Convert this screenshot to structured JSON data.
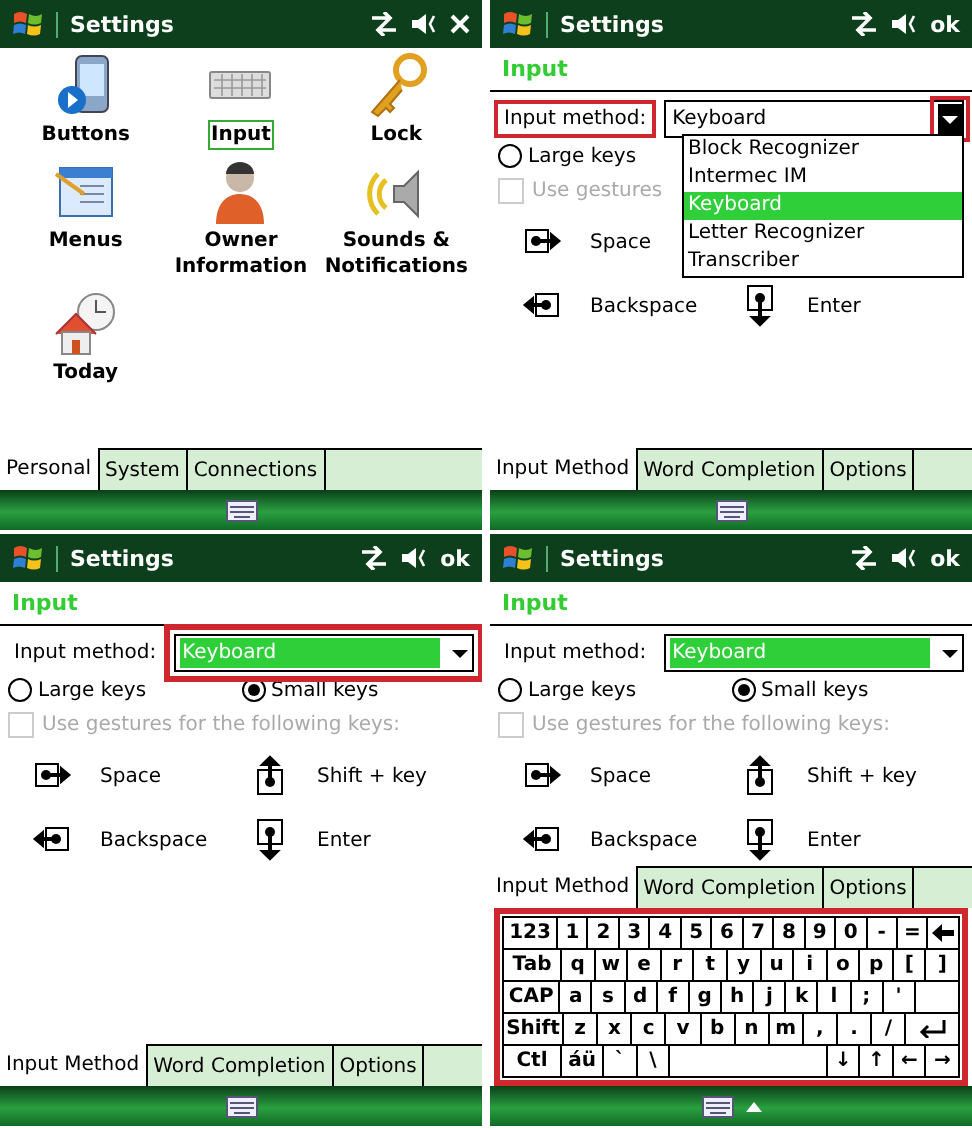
{
  "panels": [
    {
      "kind": "grid",
      "title": "Settings",
      "close": true,
      "items": [
        {
          "label": "Buttons",
          "selected": false
        },
        {
          "label": "Input",
          "selected": true
        },
        {
          "label": "Lock",
          "selected": false
        },
        {
          "label": "Menus",
          "selected": false
        },
        {
          "label": "Owner Information",
          "selected": false
        },
        {
          "label": "Sounds & Notifications",
          "selected": false
        },
        {
          "label": "Today",
          "selected": false
        }
      ],
      "tabs": [
        {
          "label": "Personal",
          "selected": true
        },
        {
          "label": "System",
          "selected": false
        },
        {
          "label": "Connections",
          "selected": false
        }
      ]
    },
    {
      "kind": "input",
      "title": "Settings",
      "action": "ok",
      "heading": "Input",
      "method_label": "Input method:",
      "label_highlight": true,
      "method_value": "Keyboard",
      "value_selected": false,
      "field_highlight": false,
      "arrow_highlight": true,
      "options": [
        {
          "label": "Block Recognizer",
          "selected": false
        },
        {
          "label": "Intermec IM",
          "selected": false
        },
        {
          "label": "Keyboard",
          "selected": true
        },
        {
          "label": "Letter Recognizer",
          "selected": false
        },
        {
          "label": "Transcriber",
          "selected": false
        }
      ],
      "radios": [
        {
          "label": "Large keys",
          "selected": false
        }
      ],
      "gesture_checkbox": {
        "label": "Use gestures",
        "checked": false,
        "disabled": true
      },
      "gestures": [
        {
          "kind": "space",
          "label": "Space"
        },
        {
          "kind": "backspace",
          "label": "Backspace"
        },
        {
          "kind": "enter",
          "label": "Enter"
        }
      ],
      "tabs": [
        {
          "label": "Input Method",
          "selected": true
        },
        {
          "label": "Word Completion",
          "selected": false
        },
        {
          "label": "Options",
          "selected": false
        }
      ]
    },
    {
      "kind": "input",
      "title": "Settings",
      "action": "ok",
      "heading": "Input",
      "method_label": "Input method:",
      "label_highlight": false,
      "method_value": "Keyboard",
      "value_selected": true,
      "field_highlight": true,
      "arrow_highlight": false,
      "radios": [
        {
          "label": "Large keys",
          "selected": false
        },
        {
          "label": "Small keys",
          "selected": true
        }
      ],
      "gesture_checkbox": {
        "label": "Use gestures for the following keys:",
        "checked": false,
        "disabled": true
      },
      "gestures": [
        {
          "kind": "space",
          "label": "Space"
        },
        {
          "kind": "shift",
          "label": "Shift + key"
        },
        {
          "kind": "backspace",
          "label": "Backspace"
        },
        {
          "kind": "enter",
          "label": "Enter"
        }
      ],
      "tabs": [
        {
          "label": "Input Method",
          "selected": true
        },
        {
          "label": "Word Completion",
          "selected": false
        },
        {
          "label": "Options",
          "selected": false
        }
      ]
    },
    {
      "kind": "input",
      "title": "Settings",
      "action": "ok",
      "heading": "Input",
      "method_label": "Input method:",
      "label_highlight": false,
      "method_value": "Keyboard",
      "value_selected": true,
      "field_highlight": false,
      "arrow_highlight": false,
      "radios": [
        {
          "label": "Large keys",
          "selected": false
        },
        {
          "label": "Small keys",
          "selected": true
        }
      ],
      "gesture_checkbox": {
        "label": "Use gestures for the following keys:",
        "checked": false,
        "disabled": true
      },
      "gestures": [
        {
          "kind": "space",
          "label": "Space"
        },
        {
          "kind": "shift",
          "label": "Shift + key"
        },
        {
          "kind": "backspace",
          "label": "Backspace"
        },
        {
          "kind": "enter",
          "label": "Enter"
        }
      ],
      "tabs": [
        {
          "label": "Input Method",
          "selected": true
        },
        {
          "label": "Word Completion",
          "selected": false
        },
        {
          "label": "Options",
          "selected": false
        }
      ],
      "keyboard": {
        "highlight": true,
        "rows": [
          {
            "keys": [
              {
                "kind": "text",
                "label": "123"
              },
              {
                "kind": "text",
                "label": "1"
              },
              {
                "kind": "text",
                "label": "2"
              },
              {
                "kind": "text",
                "label": "3"
              },
              {
                "kind": "text",
                "label": "4"
              },
              {
                "kind": "text",
                "label": "5"
              },
              {
                "kind": "text",
                "label": "6"
              },
              {
                "kind": "text",
                "label": "7"
              },
              {
                "kind": "text",
                "label": "8"
              },
              {
                "kind": "text",
                "label": "9"
              },
              {
                "kind": "text",
                "label": "0"
              },
              {
                "kind": "text",
                "label": "-"
              },
              {
                "kind": "text",
                "label": "="
              },
              {
                "kind": "backspace"
              }
            ]
          },
          {
            "keys": [
              {
                "kind": "text",
                "label": "Tab"
              },
              {
                "kind": "text",
                "label": "q"
              },
              {
                "kind": "text",
                "label": "w"
              },
              {
                "kind": "text",
                "label": "e"
              },
              {
                "kind": "text",
                "label": "r"
              },
              {
                "kind": "text",
                "label": "t"
              },
              {
                "kind": "text",
                "label": "y"
              },
              {
                "kind": "text",
                "label": "u"
              },
              {
                "kind": "text",
                "label": "i"
              },
              {
                "kind": "text",
                "label": "o"
              },
              {
                "kind": "text",
                "label": "p"
              },
              {
                "kind": "text",
                "label": "["
              },
              {
                "kind": "text",
                "label": "]"
              }
            ]
          },
          {
            "keys": [
              {
                "kind": "text",
                "label": "CAP"
              },
              {
                "kind": "text",
                "label": "a"
              },
              {
                "kind": "text",
                "label": "s"
              },
              {
                "kind": "text",
                "label": "d"
              },
              {
                "kind": "text",
                "label": "f"
              },
              {
                "kind": "text",
                "label": "g"
              },
              {
                "kind": "text",
                "label": "h"
              },
              {
                "kind": "text",
                "label": "j"
              },
              {
                "kind": "text",
                "label": "k"
              },
              {
                "kind": "text",
                "label": "l"
              },
              {
                "kind": "text",
                "label": ";"
              },
              {
                "kind": "text",
                "label": "'"
              },
              {
                "kind": "blank"
              }
            ]
          },
          {
            "keys": [
              {
                "kind": "text",
                "label": "Shift"
              },
              {
                "kind": "text",
                "label": "z"
              },
              {
                "kind": "text",
                "label": "x"
              },
              {
                "kind": "text",
                "label": "c"
              },
              {
                "kind": "text",
                "label": "v"
              },
              {
                "kind": "text",
                "label": "b"
              },
              {
                "kind": "text",
                "label": "n"
              },
              {
                "kind": "text",
                "label": "m"
              },
              {
                "kind": "text",
                "label": ","
              },
              {
                "kind": "text",
                "label": "."
              },
              {
                "kind": "text",
                "label": "/"
              },
              {
                "kind": "enter"
              }
            ]
          },
          {
            "keys": [
              {
                "kind": "text",
                "label": "Ctl"
              },
              {
                "kind": "text",
                "label": "áü"
              },
              {
                "kind": "text",
                "label": "`"
              },
              {
                "kind": "text",
                "label": "\\"
              },
              {
                "kind": "space"
              },
              {
                "kind": "text",
                "label": "↓"
              },
              {
                "kind": "text",
                "label": "↑"
              },
              {
                "kind": "text",
                "label": "←"
              },
              {
                "kind": "text",
                "label": "→"
              }
            ]
          }
        ]
      }
    }
  ]
}
